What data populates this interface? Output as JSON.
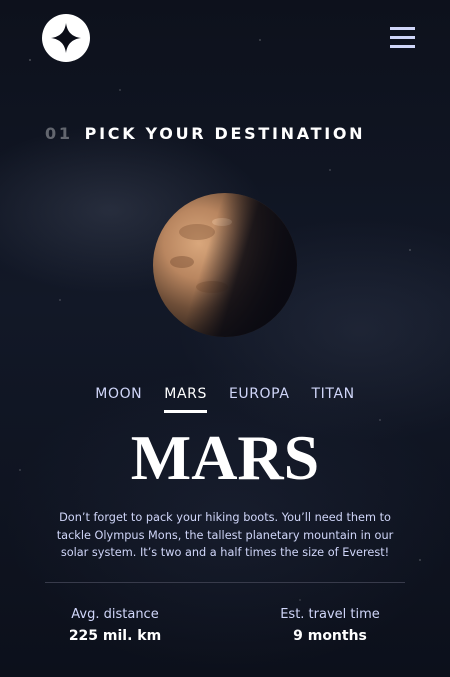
{
  "header": {
    "logo_icon": "four-point-star-icon",
    "menu_icon": "hamburger-menu-icon"
  },
  "section": {
    "number": "01",
    "title": "PICK YOUR DESTINATION"
  },
  "planet_image": {
    "icon": "mars-planet-image"
  },
  "tabs": [
    {
      "label": "MOON",
      "active": false
    },
    {
      "label": "MARS",
      "active": true
    },
    {
      "label": "EUROPA",
      "active": false
    },
    {
      "label": "TITAN",
      "active": false
    }
  ],
  "destination": {
    "name": "MARS",
    "description": "Don’t forget to pack your hiking boots. You’ll need them to tackle Olympus Mons, the tallest planetary mountain in our solar system. It’s two and a half times the size of Everest!",
    "stats": {
      "distance_label": "Avg. distance",
      "distance_value": "225 mil. km",
      "travel_label": "Est. travel time",
      "travel_value": "9 months"
    }
  },
  "colors": {
    "background": "#0b0d17",
    "accent": "#d0d6f9",
    "text": "#ffffff"
  }
}
